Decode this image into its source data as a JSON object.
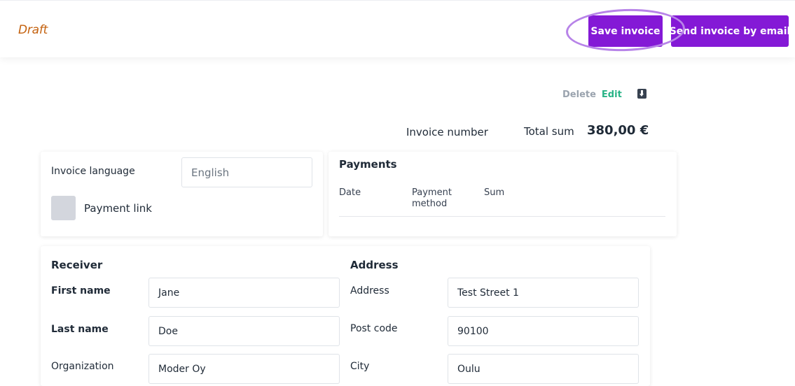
{
  "header": {
    "status": "Draft",
    "save_label": "Save invoice",
    "send_label": "Send invoice by email"
  },
  "actions": {
    "delete_label": "Delete",
    "edit_label": "Edit",
    "download_icon": "download-icon"
  },
  "summary": {
    "invoice_number_label": "Invoice number",
    "total_label": "Total sum",
    "total_value": "380,00 €"
  },
  "settings": {
    "language_label": "Invoice language",
    "language_value": "English",
    "payment_link_label": "Payment link"
  },
  "payments": {
    "title": "Payments",
    "columns": [
      "Date",
      "Payment method",
      "Sum"
    ]
  },
  "receiver": {
    "title": "Receiver",
    "first_name_label": "First name",
    "first_name_value": "Jane",
    "last_name_label": "Last name",
    "last_name_value": "Doe",
    "organization_label": "Organization",
    "organization_value": "Moder Oy"
  },
  "address": {
    "title": "Address",
    "address_label": "Address",
    "address_value": "Test Street 1",
    "postcode_label": "Post code",
    "postcode_value": "90100",
    "city_label": "City",
    "city_value": "Oulu"
  },
  "colors": {
    "accent": "#8419d6",
    "status": "#c4620f",
    "edit": "#28b386",
    "highlight": "#b783e8"
  }
}
